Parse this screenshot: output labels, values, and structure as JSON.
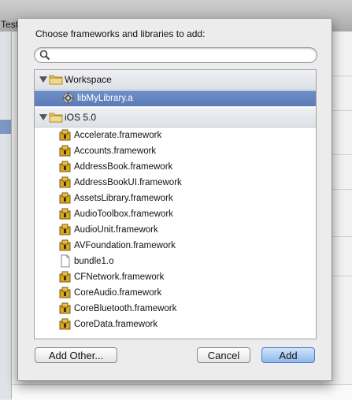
{
  "background_window": {
    "title": "Test"
  },
  "sheet": {
    "title": "Choose frameworks and libraries to add:",
    "search": {
      "value": "",
      "placeholder": ""
    },
    "groups": [
      {
        "label": "Workspace",
        "items": [
          {
            "label": "libMyLibrary.a",
            "icon": "library-icon",
            "selected": true
          }
        ]
      },
      {
        "label": "iOS 5.0",
        "items": [
          {
            "label": "Accelerate.framework",
            "icon": "framework-icon"
          },
          {
            "label": "Accounts.framework",
            "icon": "framework-icon"
          },
          {
            "label": "AddressBook.framework",
            "icon": "framework-icon"
          },
          {
            "label": "AddressBookUI.framework",
            "icon": "framework-icon"
          },
          {
            "label": "AssetsLibrary.framework",
            "icon": "framework-icon"
          },
          {
            "label": "AudioToolbox.framework",
            "icon": "framework-icon"
          },
          {
            "label": "AudioUnit.framework",
            "icon": "framework-icon"
          },
          {
            "label": "AVFoundation.framework",
            "icon": "framework-icon"
          },
          {
            "label": "bundle1.o",
            "icon": "file-icon"
          },
          {
            "label": "CFNetwork.framework",
            "icon": "framework-icon"
          },
          {
            "label": "CoreAudio.framework",
            "icon": "framework-icon"
          },
          {
            "label": "CoreBluetooth.framework",
            "icon": "framework-icon"
          },
          {
            "label": "CoreData.framework",
            "icon": "framework-icon"
          }
        ]
      }
    ],
    "buttons": {
      "add_other": "Add Other...",
      "cancel": "Cancel",
      "add": "Add"
    }
  }
}
